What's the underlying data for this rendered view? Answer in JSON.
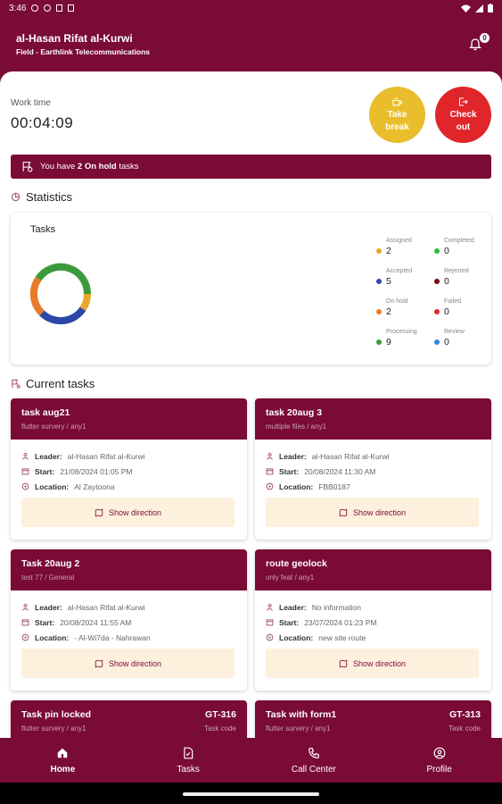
{
  "status_bar": {
    "time": "3:46"
  },
  "header": {
    "user_name": "al-Hasan Rifat al-Kurwi",
    "subtitle": "Field - Earthlink Telecommunications",
    "notification_count": "0"
  },
  "work_time": {
    "label": "Work time",
    "value": "00:04:09"
  },
  "actions": {
    "take_break": [
      "Take",
      "break"
    ],
    "check_out": [
      "Check",
      "out"
    ]
  },
  "onhold_banner": {
    "prefix": "You have",
    "count": "2 On hold",
    "suffix": "tasks"
  },
  "statistics": {
    "title": "Statistics",
    "chart_label": "Tasks",
    "legend": [
      {
        "name": "Assigned",
        "value": "2",
        "color": "#e9a82b"
      },
      {
        "name": "Completed",
        "value": "0",
        "color": "#2bbd3a"
      },
      {
        "name": "Accepted",
        "value": "5",
        "color": "#2c47a8"
      },
      {
        "name": "Rejected",
        "value": "0",
        "color": "#7a0a10"
      },
      {
        "name": "On hold",
        "value": "2",
        "color": "#e87b2a"
      },
      {
        "name": "Failed",
        "value": "0",
        "color": "#e0262a"
      },
      {
        "name": "Processing",
        "value": "9",
        "color": "#3a9b3a"
      },
      {
        "name": "Review",
        "value": "0",
        "color": "#2f8ae0"
      }
    ]
  },
  "current_tasks": {
    "title": "Current tasks",
    "labels": {
      "leader": "Leader:",
      "start": "Start:",
      "location": "Location:",
      "direction": "Show direction",
      "task_code": "Task code"
    },
    "tasks": [
      {
        "title": "task aug21",
        "sub": "flutter survery / any1",
        "leader": "al-Hasan Rifat al-Kurwi",
        "start": "21/08/2024 01:05 PM",
        "location": "Al Zaytoona"
      },
      {
        "title": "task 20aug 3",
        "sub": "multiple files / any1",
        "leader": "al-Hasan Rifat al-Kurwi",
        "start": "20/08/2024 11:30 AM",
        "location": "FBB0187"
      },
      {
        "title": "Task 20aug 2",
        "sub": "test 77 / General",
        "leader": "al-Hasan Rifat al-Kurwi",
        "start": "20/08/2024 11:55 AM",
        "location": "- Al-Wi7da - Nahrawan"
      },
      {
        "title": "route geolock",
        "sub": "only feat / any1",
        "leader": "No information",
        "start": "23/07/2024 01:23 PM",
        "location": "new site route"
      },
      {
        "title": "Task pin locked",
        "sub": "flutter survery / any1",
        "code": "GT-316"
      },
      {
        "title": "Task with form1",
        "sub": "flutter survery / any1",
        "code": "GT-313"
      }
    ]
  },
  "bottom_nav": {
    "home": "Home",
    "tasks": "Tasks",
    "call_center": "Call Center",
    "profile": "Profile"
  }
}
